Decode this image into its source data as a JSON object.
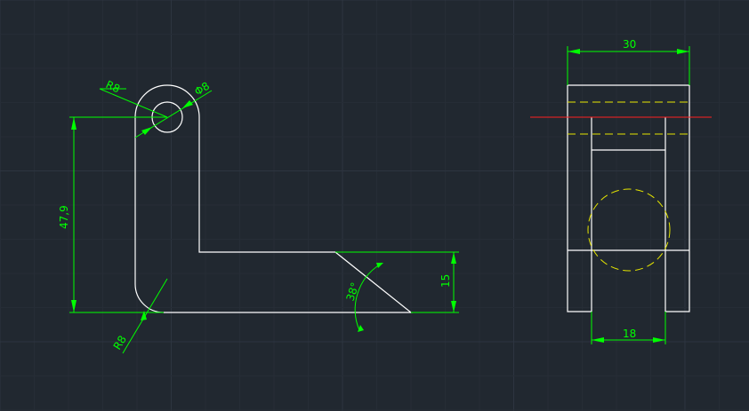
{
  "colors": {
    "background": "#212830",
    "grid_major": "#2d3540",
    "grid_minor": "#262d36",
    "geometry": "#ffffff",
    "dimension": "#00ff00",
    "hidden_line": "#e6e600",
    "center_line": "#ff2020"
  },
  "front_view": {
    "dim_radius_top": "R8",
    "dim_hole": "Φ8",
    "dim_height": "47,9",
    "dim_radius_bottom": "R8",
    "dim_angle": "38°",
    "dim_chamfer_height": "15"
  },
  "side_view": {
    "dim_width": "30",
    "dim_slot": "18"
  }
}
